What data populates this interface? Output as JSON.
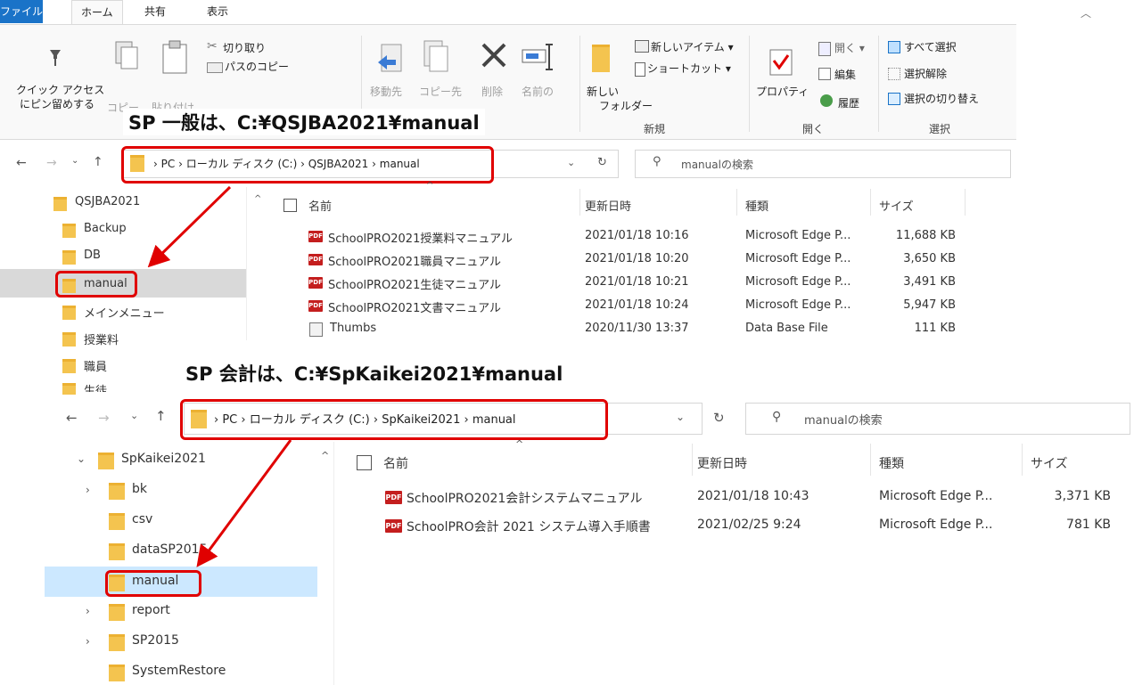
{
  "ribbon": {
    "tabs": [
      "ファイル",
      "ホーム",
      "共有",
      "表示"
    ],
    "clipboard": {
      "pin": "クイック アクセス",
      "pin2": "にピン留めする",
      "copy": "コピー",
      "paste": "貼り付け",
      "cut": "切り取り",
      "copy_path": "パスのコピー"
    },
    "organize": {
      "move": "移動先",
      "copy_to": "コピー先",
      "delete": "削除",
      "rename": "名前の"
    },
    "new_group": {
      "new_item": "新しいアイテム ▾",
      "shortcut": "ショートカット ▾",
      "new_folder": "新しい",
      "new_folder2": "フォルダー",
      "label": "新規"
    },
    "open_group": {
      "properties": "プロパティ",
      "open": "開く ▾",
      "edit": "編集",
      "history": "履歴",
      "label": "開く"
    },
    "select_group": {
      "all": "すべて選択",
      "none": "選択解除",
      "invert": "選択の切り替え",
      "label": "選択"
    }
  },
  "callouts": {
    "top": "SP 一般は、C:¥QSJBA2021¥manual",
    "bottom": "SP 会計は、C:¥SpKaikei2021¥manual"
  },
  "top": {
    "breadcrumb": [
      "PC",
      "ローカル ディスク (C:)",
      "QSJBA2021",
      "manual"
    ],
    "search_placeholder": "manualの検索",
    "tree": [
      "QSJBA2021",
      "Backup",
      "DB",
      "manual",
      "メインメニュー",
      "授業料",
      "職員",
      "生徒"
    ],
    "headers": {
      "name": "名前",
      "date": "更新日時",
      "type": "種類",
      "size": "サイズ"
    },
    "files": [
      {
        "name": "SchoolPRO2021授業料マニュアル",
        "date": "2021/01/18 10:16",
        "type": "Microsoft Edge P...",
        "size": "11,688 KB",
        "icon": "pdf"
      },
      {
        "name": "SchoolPRO2021職員マニュアル",
        "date": "2021/01/18 10:20",
        "type": "Microsoft Edge P...",
        "size": "3,650 KB",
        "icon": "pdf"
      },
      {
        "name": "SchoolPRO2021生徒マニュアル",
        "date": "2021/01/18 10:21",
        "type": "Microsoft Edge P...",
        "size": "3,491 KB",
        "icon": "pdf"
      },
      {
        "name": "SchoolPRO2021文書マニュアル",
        "date": "2021/01/18 10:24",
        "type": "Microsoft Edge P...",
        "size": "5,947 KB",
        "icon": "pdf"
      },
      {
        "name": "Thumbs",
        "date": "2020/11/30 13:37",
        "type": "Data Base File",
        "size": "111 KB",
        "icon": "db"
      }
    ]
  },
  "bottom": {
    "breadcrumb": [
      "PC",
      "ローカル ディスク (C:)",
      "SpKaikei2021",
      "manual"
    ],
    "search_placeholder": "manualの検索",
    "tree": [
      "SpKaikei2021",
      "bk",
      "csv",
      "dataSP2015",
      "manual",
      "report",
      "SP2015",
      "SystemRestore"
    ],
    "headers": {
      "name": "名前",
      "date": "更新日時",
      "type": "種類",
      "size": "サイズ"
    },
    "files": [
      {
        "name": "SchoolPRO2021会計システムマニュアル",
        "date": "2021/01/18 10:43",
        "type": "Microsoft Edge P...",
        "size": "3,371 KB",
        "icon": "pdf"
      },
      {
        "name": "SchoolPRO会計 2021 システム導入手順書",
        "date": "2021/02/25 9:24",
        "type": "Microsoft Edge P...",
        "size": "781 KB",
        "icon": "pdf"
      }
    ]
  },
  "icons": {
    "pdf_label": "PDF"
  },
  "colors": {
    "accent": "#1a73c8",
    "highlight": "#e00000",
    "folder": "#f4c44f",
    "selected_gray": "#d9d9d9",
    "selected_blue": "#cce8ff"
  }
}
